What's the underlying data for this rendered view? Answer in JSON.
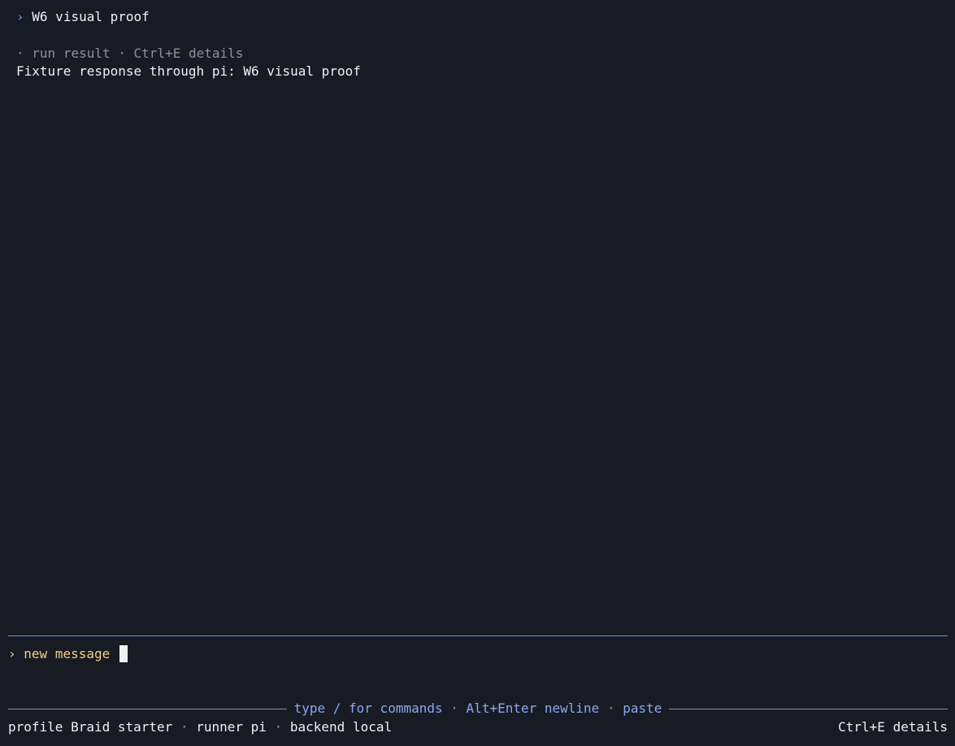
{
  "transcript": {
    "user_message": {
      "chevron": "›",
      "text": "W6 visual proof"
    },
    "run_meta": {
      "bullet": "·",
      "label": "run result",
      "separator": "·",
      "details_hint": "Ctrl+E details"
    },
    "response_text": "Fixture response through pi: W6 visual proof"
  },
  "composer": {
    "chevron": "›",
    "placeholder": "new message"
  },
  "hints": {
    "commands": "type / for commands",
    "newline": "Alt+Enter newline",
    "paste": "paste",
    "separator": "·"
  },
  "status": {
    "profile_label": "profile",
    "profile_value": "Braid starter",
    "runner_label": "runner",
    "runner_value": "pi",
    "backend_label": "backend",
    "backend_value": "local",
    "separator": "·",
    "details_shortcut": "Ctrl+E details"
  },
  "colors": {
    "background": "#181b23",
    "text": "#eef0f4",
    "muted": "#8c919a",
    "accent": "#8aa9f0",
    "composer_text": "#f1cf86",
    "composer_rule": "#6f8fe0"
  }
}
